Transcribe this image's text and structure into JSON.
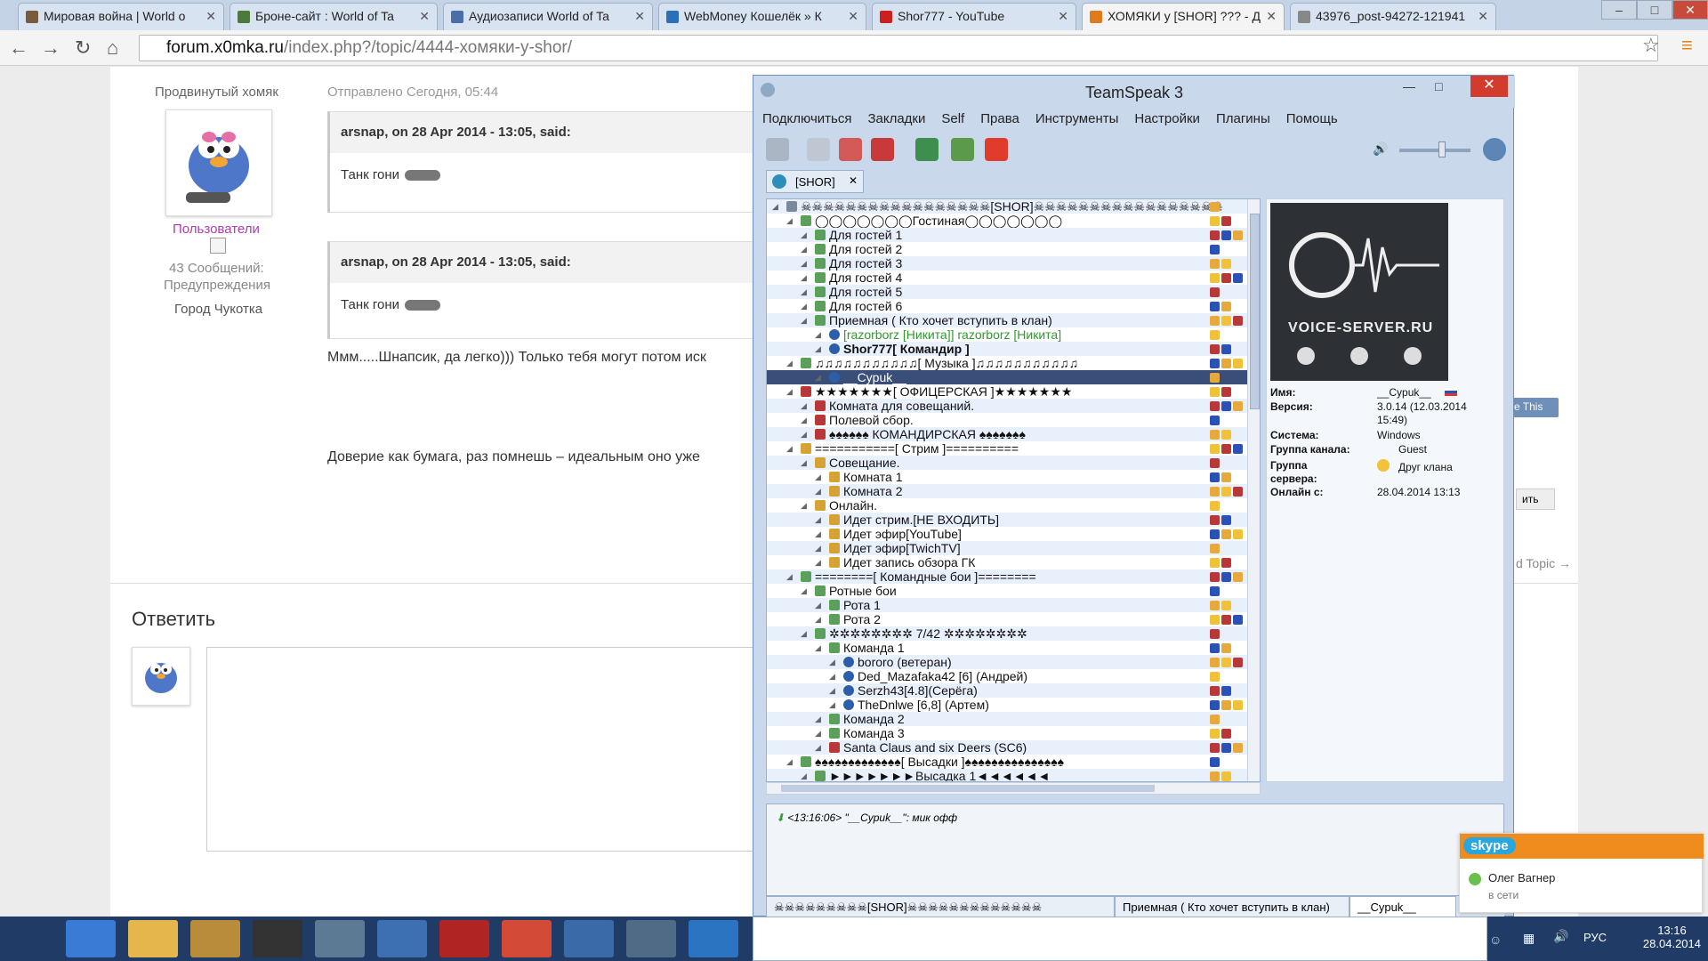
{
  "browser": {
    "tabs": [
      {
        "label": "Мировая война | World o",
        "favicon_color": "#7a5a3c"
      },
      {
        "label": "Броне-сайт : World of Ta",
        "favicon_color": "#4b7a3c"
      },
      {
        "label": "Аудиозаписи World of Ta",
        "favicon_color": "#4a6ea8"
      },
      {
        "label": "WebMoney Кошелёк » К",
        "favicon_color": "#2a6fb8"
      },
      {
        "label": "Shor777 - YouTube",
        "favicon_color": "#cc1f1f"
      },
      {
        "label": "ХОМЯКИ у [SHOR] ??? - Д",
        "favicon_color": "#e07b1d",
        "active": true
      },
      {
        "label": "43976_post-94272-121941",
        "favicon_color": "#888"
      }
    ],
    "address": {
      "host": "forum.x0mka.ru",
      "path": "/index.php?/topic/4444-хомяки-у-shor/"
    }
  },
  "forum": {
    "user_rank": "Продвинутый хомяк",
    "user_group": "Пользователи",
    "user_posts": "43 Сообщений:",
    "user_warnings": "Предупреждения",
    "user_city": "Город Чукотка",
    "post_date": "Отправлено Сегодня, 05:44",
    "quote1_head": "arsnap, on 28 Apr 2014 - 13:05, said:",
    "quote1_body": "Танк гони",
    "quote2_head": "arsnap, on 28 Apr 2014 - 13:05, said:",
    "quote2_body": "Танк гони",
    "post_line1": "Ммм.....Шнапсик, да легко))) Только тебя могут потом иск",
    "post_line2": "Доверие как бумага, раз помнешь – идеальным оно уже",
    "reply_title": "Ответить",
    "like_this": "e This",
    "reply_btn": "ить",
    "next_topic": "d Topic →"
  },
  "teamspeak": {
    "title": "TeamSpeak 3",
    "menu": [
      "Подключиться",
      "Закладки",
      "Self",
      "Права",
      "Инструменты",
      "Настройки",
      "Плагины",
      "Помощь"
    ],
    "server_tab": "[SHOR]",
    "tree": [
      {
        "text": "☠☠☠☠☠☠☠☠☠☠☠☠☠☠☠☠☠[SHOR]☠☠☠☠☠☠☠☠☠☠☠☠☠☠☠☠☠",
        "indent": 0,
        "icon": "#7a8a9a"
      },
      {
        "text": "◯◯◯◯◯◯◯Гостиная◯◯◯◯◯◯◯",
        "indent": 1,
        "icon": "#5aa05a"
      },
      {
        "text": "Для гостей 1",
        "indent": 2,
        "icon": "#5aa05a"
      },
      {
        "text": "Для гостей 2",
        "indent": 2,
        "icon": "#5aa05a"
      },
      {
        "text": "Для гостей 3",
        "indent": 2,
        "icon": "#5aa05a"
      },
      {
        "text": "Для гостей 4",
        "indent": 2,
        "icon": "#5aa05a"
      },
      {
        "text": "Для гостей 5",
        "indent": 2,
        "icon": "#5aa05a"
      },
      {
        "text": "Для гостей 6",
        "indent": 2,
        "icon": "#5aa05a"
      },
      {
        "text": "Приемная ( Кто хочет вступить в клан)",
        "indent": 2,
        "icon": "#5aa05a"
      },
      {
        "text": "[razorborz [Никита]] razorborz [Никита]",
        "indent": 3,
        "icon": "#2c5fa8",
        "color": "#2e9a2e"
      },
      {
        "text": "Shor777[ Командир ]",
        "indent": 3,
        "icon": "#2c5fa8",
        "bold": true
      },
      {
        "text": "♫♫♫♫♫♫♫♫♫♫♫[ Музыка ]♫♫♫♫♫♫♫♫♫♫♫",
        "indent": 1,
        "icon": "#5aa05a"
      },
      {
        "text": "__Cypuk__",
        "indent": 3,
        "icon": "#2c5fa8",
        "selected": true
      },
      {
        "text": "★★★★★★★[ ОФИЦЕРСКАЯ ]★★★★★★★",
        "indent": 1,
        "icon": "#b83838"
      },
      {
        "text": "Комната для совещаний.",
        "indent": 2,
        "icon": "#b83838"
      },
      {
        "text": "Полевой сбор.",
        "indent": 2,
        "icon": "#b83838"
      },
      {
        "text": "♠♠♠♠♠♠ КОМАНДИРСКАЯ ♠♠♠♠♠♠♠",
        "indent": 2,
        "icon": "#b83838"
      },
      {
        "text": "===========[ Стрим ]==========",
        "indent": 1,
        "icon": "#d7a235"
      },
      {
        "text": "Совещание.",
        "indent": 2,
        "icon": "#d7a235"
      },
      {
        "text": "Комната 1",
        "indent": 3,
        "icon": "#d7a235"
      },
      {
        "text": "Комната 2",
        "indent": 3,
        "icon": "#d7a235"
      },
      {
        "text": "Онлайн.",
        "indent": 2,
        "icon": "#d7a235"
      },
      {
        "text": "Идет стрим.[НЕ ВХОДИТЬ]",
        "indent": 3,
        "icon": "#d7a235"
      },
      {
        "text": "Идет эфир[YouTube]",
        "indent": 3,
        "icon": "#d7a235"
      },
      {
        "text": "Идет эфир[TwichTV]",
        "indent": 3,
        "icon": "#d7a235"
      },
      {
        "text": "Идет запись обзора ГК",
        "indent": 3,
        "icon": "#d7a235"
      },
      {
        "text": "========[ Командные бои ]========",
        "indent": 1,
        "icon": "#5aa05a"
      },
      {
        "text": "Ротные бои",
        "indent": 2,
        "icon": "#5aa05a"
      },
      {
        "text": "Рота 1",
        "indent": 3,
        "icon": "#5aa05a"
      },
      {
        "text": "Рота 2",
        "indent": 3,
        "icon": "#5aa05a"
      },
      {
        "text": "✲✲✲✲✲✲✲✲ 7/42 ✲✲✲✲✲✲✲✲",
        "indent": 2,
        "icon": "#5aa05a"
      },
      {
        "text": "Команда 1",
        "indent": 3,
        "icon": "#5aa05a"
      },
      {
        "text": "bororo (ветеран)",
        "indent": 4,
        "icon": "#2c5fa8"
      },
      {
        "text": "Ded_Mazafaka42 [6] (Андрей)",
        "indent": 4,
        "icon": "#2c5fa8"
      },
      {
        "text": "Serzh43[4.8](Серёга)",
        "indent": 4,
        "icon": "#2c5fa8"
      },
      {
        "text": "TheDnlwe [6,8] (Артем)",
        "indent": 4,
        "icon": "#2c5fa8"
      },
      {
        "text": "Команда 2",
        "indent": 3,
        "icon": "#5aa05a"
      },
      {
        "text": "Команда 3",
        "indent": 3,
        "icon": "#5aa05a"
      },
      {
        "text": "Santa Claus and six Deers (SC6)",
        "indent": 3,
        "icon": "#b83838"
      },
      {
        "text": "♠♠♠♠♠♠♠♠♠♠♠♠♠[ Высадки ]♠♠♠♠♠♠♠♠♠♠♠♠♠♠♠",
        "indent": 1,
        "icon": "#5aa05a"
      },
      {
        "text": "►►►►►►►Высадка 1◄◄◄◄◄◄",
        "indent": 2,
        "icon": "#5aa05a"
      }
    ],
    "banner_brand": "VOICE-SERVER.RU",
    "info": {
      "name_label": "Имя:",
      "name": "__Cypuk__",
      "version_label": "Версия:",
      "version": "3.0.14 (12.03.2014 15:49)",
      "system_label": "Система:",
      "system": "Windows",
      "chgroup_label": "Группа канала:",
      "chgroup": "Guest",
      "srvgroup_label": "Группа сервера:",
      "srvgroup": "Друг клана",
      "online_label": "Онлайн с:",
      "online": "28.04.2014 13:13"
    },
    "chat_line": "<13:16:06> \"__Cypuk__\": мик офф",
    "chat_tabs": [
      "☠☠☠☠☠☠☠☠☠[SHOR]☠☠☠☠☠☠☠☠☠☠☠☠☠",
      "Приемная ( Кто хочет вступить в клан)",
      "__Cypuk__"
    ]
  },
  "skype": {
    "logo": "skype",
    "contact": "Олег Вагнер",
    "status": "в сети"
  },
  "taskbar": {
    "lang": "РУС",
    "time": "13:16",
    "date": "28.04.2014",
    "apps": [
      {
        "name": "start",
        "color": "#1f3b66"
      },
      {
        "name": "ie",
        "color": "#3a7bd5"
      },
      {
        "name": "explorer",
        "color": "#e4b64b"
      },
      {
        "name": "app1",
        "color": "#b98c3c"
      },
      {
        "name": "app2",
        "color": "#333"
      },
      {
        "name": "app3",
        "color": "#5d7a95"
      },
      {
        "name": "app4",
        "color": "#3d6fb3"
      },
      {
        "name": "power",
        "color": "#b02424"
      },
      {
        "name": "chrome",
        "color": "#d34a36"
      },
      {
        "name": "app5",
        "color": "#3a6aa8"
      },
      {
        "name": "teamspeak",
        "color": "#506b86"
      },
      {
        "name": "app6",
        "color": "#2a74c2"
      }
    ]
  }
}
